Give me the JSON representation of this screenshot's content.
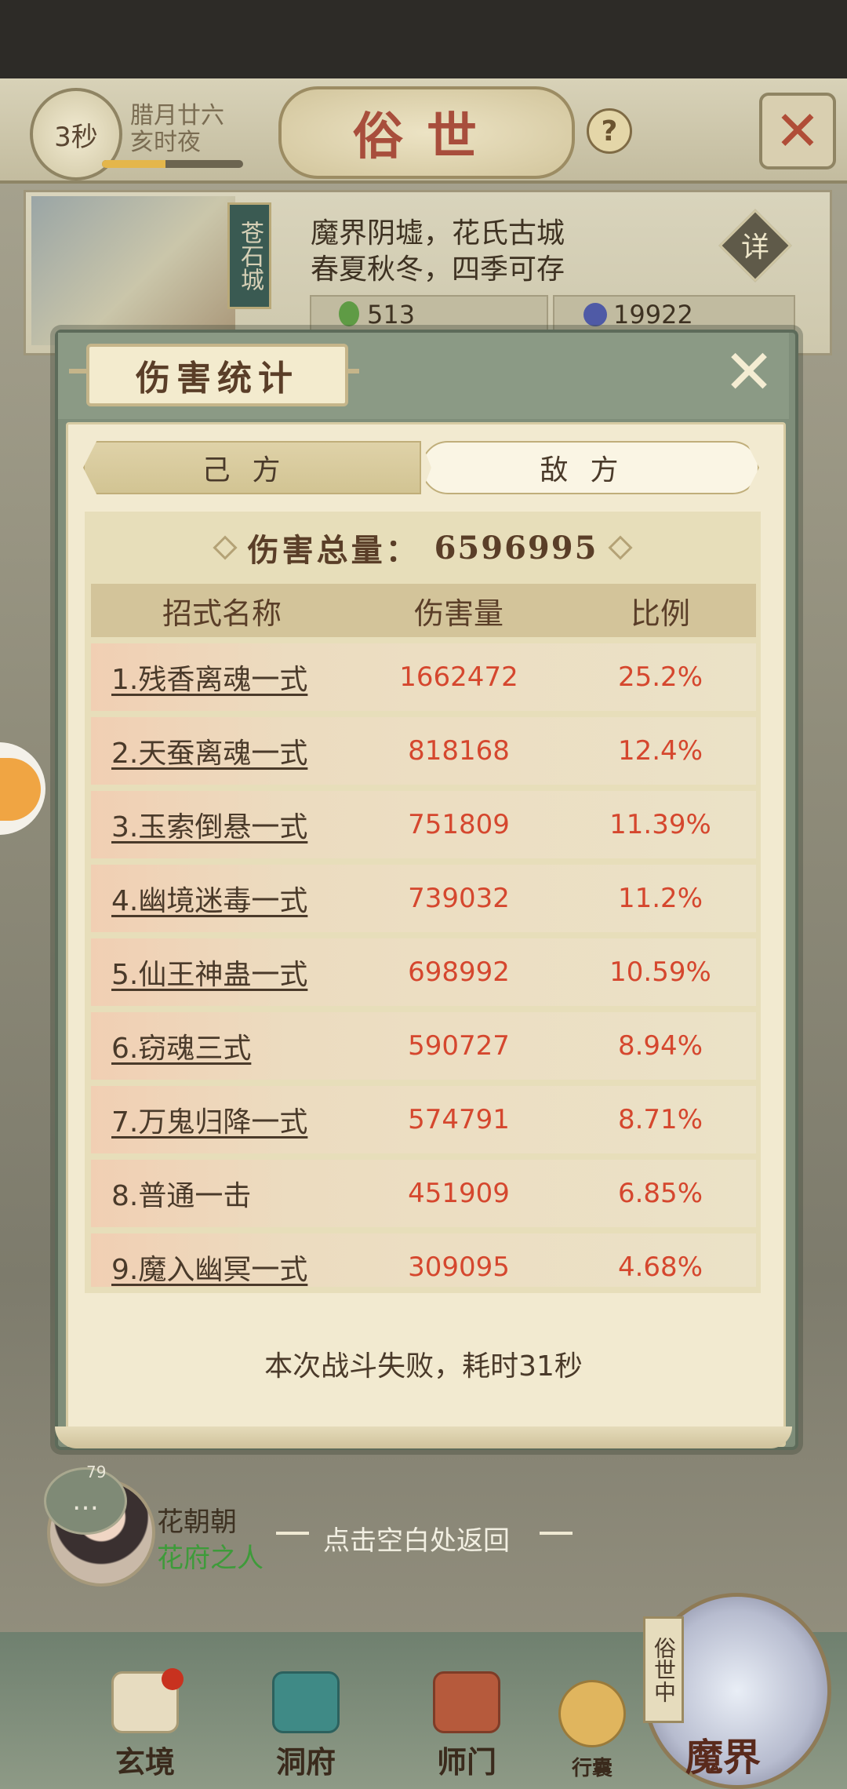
{
  "header": {
    "timer": "3秒",
    "date_line1": "腊月廿六",
    "date_line2": "亥时夜",
    "title": "俗世",
    "help": "?",
    "time_progress": 0.45
  },
  "location": {
    "city_name": "苍石城",
    "desc_line1": "魔界阴墟，花氏古城",
    "desc_line2": "春夏秋冬，四季可存",
    "detail_label": "详",
    "resource1": "513",
    "resource2": "19922"
  },
  "dialog": {
    "title": "伤害统计",
    "tabs": [
      {
        "label": "己方",
        "active": false
      },
      {
        "label": "敌方",
        "active": true
      }
    ],
    "total_label": "伤害总量：",
    "total_value": "6596995",
    "columns": {
      "name": "招式名称",
      "damage": "伤害量",
      "ratio": "比例"
    },
    "rows": [
      {
        "name": "1.残香离魂一式",
        "damage": "1662472",
        "ratio": "25.2%"
      },
      {
        "name": "2.天蚕离魂一式",
        "damage": "818168",
        "ratio": "12.4%"
      },
      {
        "name": "3.玉索倒悬一式",
        "damage": "751809",
        "ratio": "11.39%"
      },
      {
        "name": "4.幽境迷毒一式",
        "damage": "739032",
        "ratio": "11.2%"
      },
      {
        "name": "5.仙王神蛊一式",
        "damage": "698992",
        "ratio": "10.59%"
      },
      {
        "name": "6.窃魂三式",
        "damage": "590727",
        "ratio": "8.94%"
      },
      {
        "name": "7.万鬼归降一式",
        "damage": "574791",
        "ratio": "8.71%"
      },
      {
        "name": "8.普通一击",
        "damage": "451909",
        "ratio": "6.85%"
      },
      {
        "name": "9.魔入幽冥一式",
        "damage": "309095",
        "ratio": "4.68%"
      }
    ],
    "result": "本次战斗失败，耗时31秒"
  },
  "npc": {
    "level": "79",
    "name": "花朝朝",
    "subtitle": "花府之人"
  },
  "return_hint": "点击空白处返回",
  "bottom_nav": [
    {
      "label": "玄境"
    },
    {
      "label": "洞府"
    },
    {
      "label": "师门"
    },
    {
      "label": "行囊"
    },
    {
      "label": "魔界"
    }
  ],
  "world_side_label": "俗世中",
  "colors": {
    "damage_text": "#d5472e",
    "panel": "#f2ead0",
    "frame": "#7f8e7a",
    "npc_subtitle": "#3e9b3a"
  }
}
